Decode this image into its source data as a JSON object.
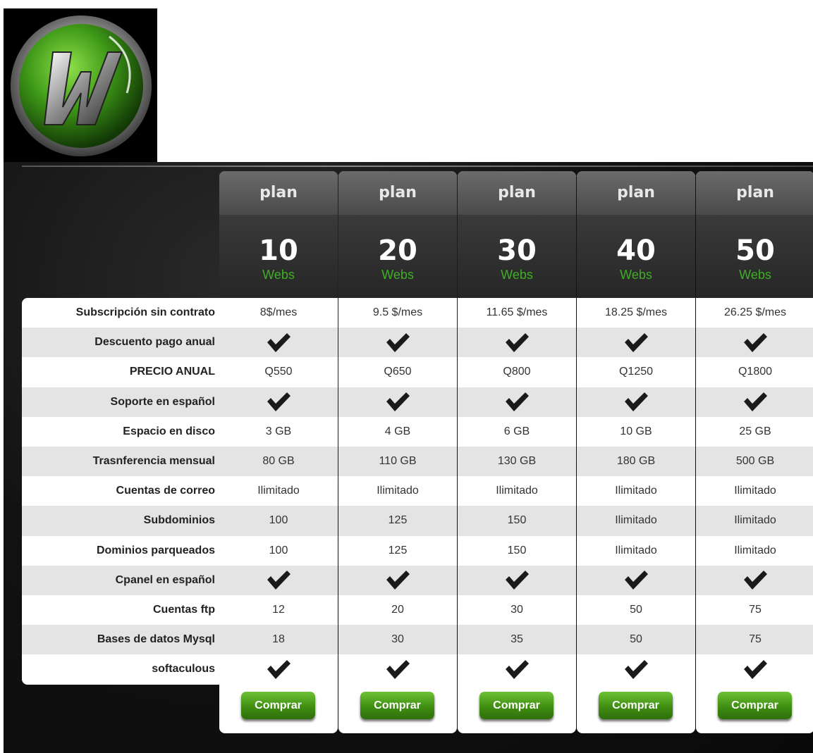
{
  "colors": {
    "accent_green": "#3fae25",
    "button_green": "#4a9a1a",
    "stripe": "#e4e4e4",
    "stage": "#111111"
  },
  "logo": {
    "icon": "w-logo-icon"
  },
  "features": [
    "Subscripción sin contrato",
    "Descuento pago anual",
    "PRECIO ANUAL",
    "Soporte en español",
    "Espacio en disco",
    "Trasnferencia mensual",
    "Cuentas de correo",
    "Subdominios",
    "Dominios parqueados",
    "Cpanel en español",
    "Cuentas ftp",
    "Bases de datos Mysql",
    "softaculous"
  ],
  "check_icon": "checkmark-icon",
  "plans": [
    {
      "head": "plan",
      "number": "10",
      "unit": "Webs",
      "button": "Comprar",
      "values": [
        "8$/mes",
        "✓",
        "Q550",
        "✓",
        "3 GB",
        "80 GB",
        "Ilimitado",
        "100",
        "100",
        "✓",
        "12",
        "18",
        "✓"
      ]
    },
    {
      "head": "plan",
      "number": "20",
      "unit": "Webs",
      "button": "Comprar",
      "values": [
        "9.5 $/mes",
        "✓",
        "Q650",
        "✓",
        "4 GB",
        "110 GB",
        "Ilimitado",
        "125",
        "125",
        "✓",
        "20",
        "30",
        "✓"
      ]
    },
    {
      "head": "plan",
      "number": "30",
      "unit": "Webs",
      "button": "Comprar",
      "values": [
        "11.65 $/mes",
        "✓",
        "Q800",
        "✓",
        "6 GB",
        "130 GB",
        "Ilimitado",
        "150",
        "150",
        "✓",
        "30",
        "35",
        "✓"
      ]
    },
    {
      "head": "plan",
      "number": "40",
      "unit": "Webs",
      "button": "Comprar",
      "values": [
        "18.25 $/mes",
        "✓",
        "Q1250",
        "✓",
        "10 GB",
        "180 GB",
        "Ilimitado",
        "Ilimitado",
        "Ilimitado",
        "✓",
        "50",
        "50",
        "✓"
      ]
    },
    {
      "head": "plan",
      "number": "50",
      "unit": "Webs",
      "button": "Comprar",
      "values": [
        "26.25 $/mes",
        "✓",
        "Q1800",
        "✓",
        "25 GB",
        "500 GB",
        "Ilimitado",
        "Ilimitado",
        "Ilimitado",
        "✓",
        "75",
        "75",
        "✓"
      ]
    }
  ]
}
